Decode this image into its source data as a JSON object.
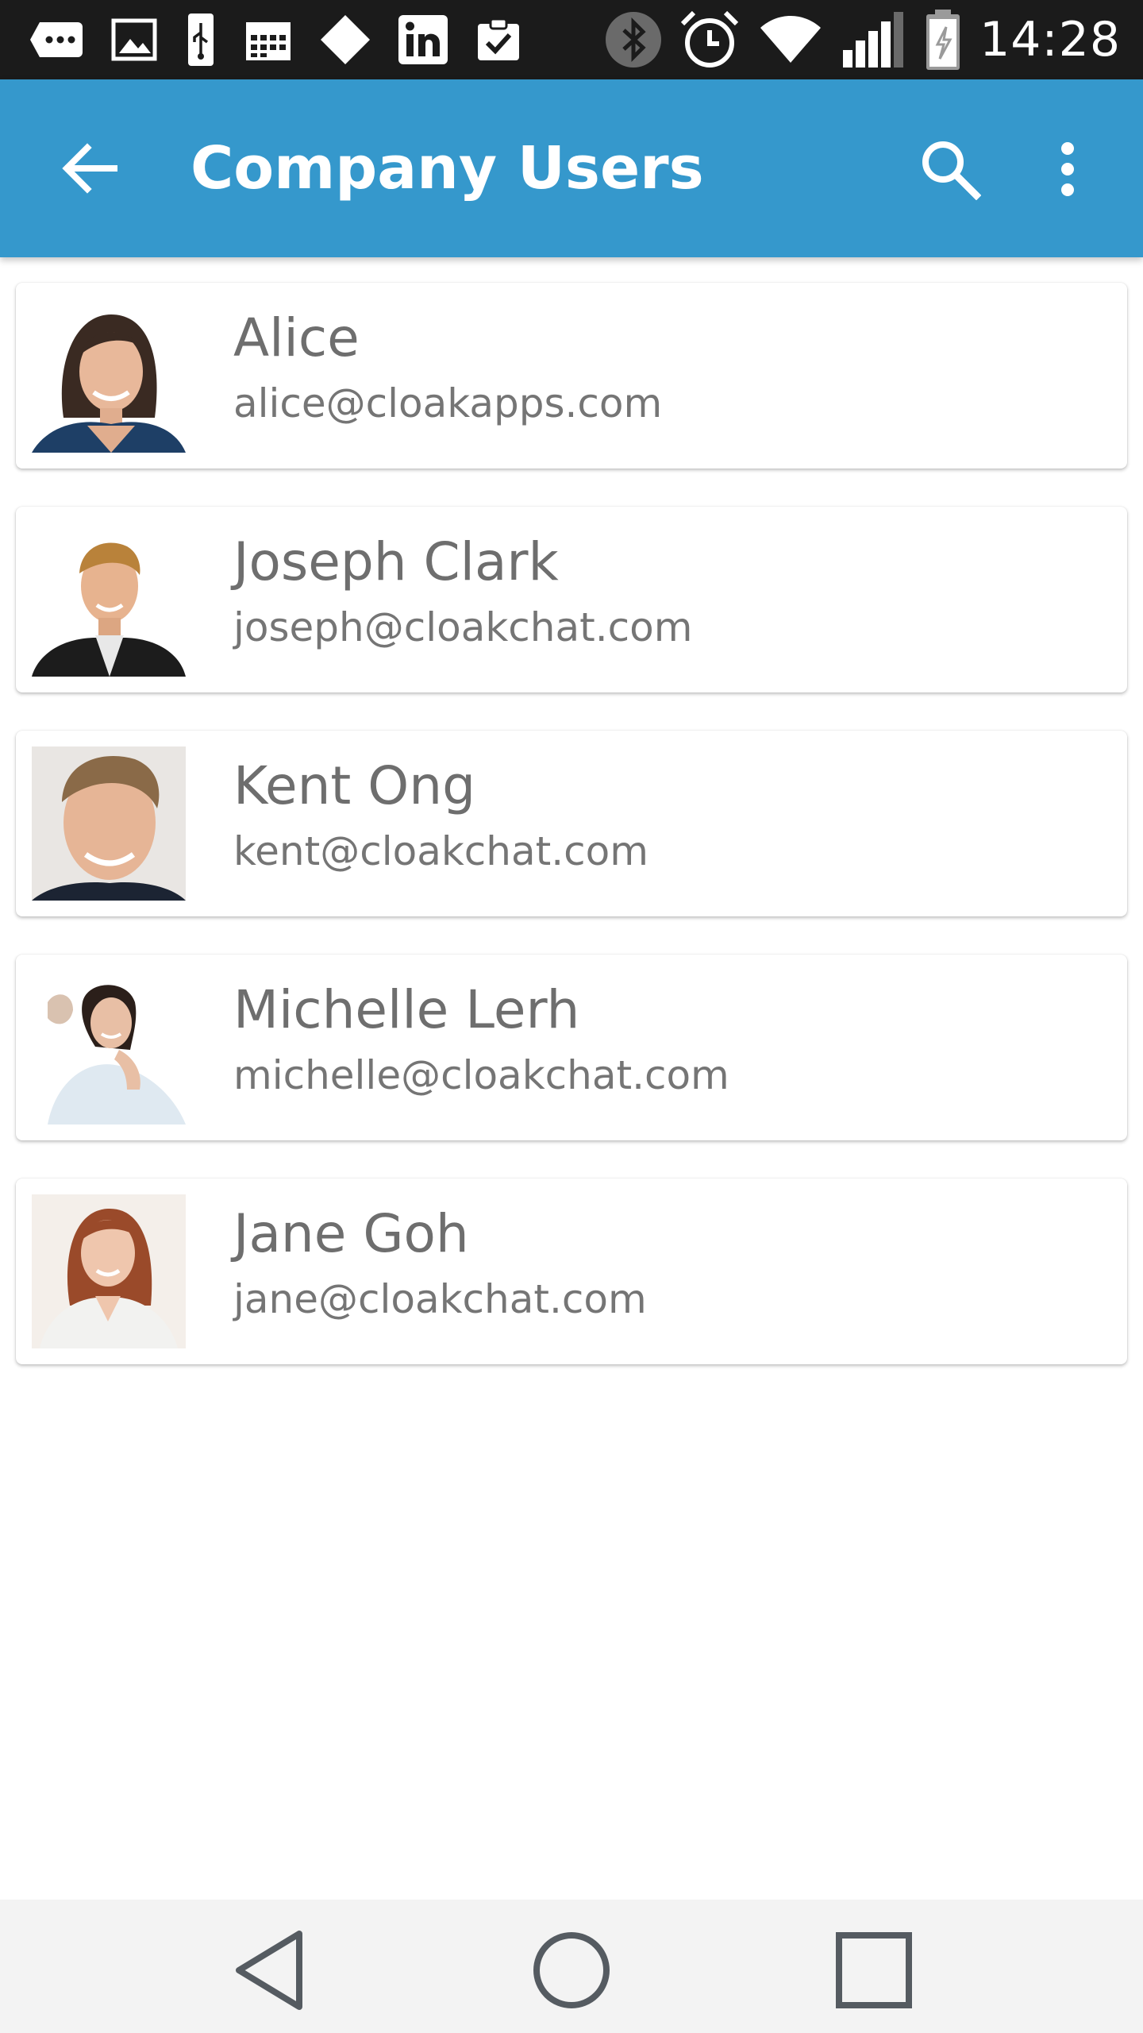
{
  "status_bar": {
    "time": "14:28",
    "left_icons": [
      "more-chat-icon",
      "image-icon",
      "usb-icon",
      "calendar-icon",
      "diamond-icon",
      "linkedin-icon",
      "clipboard-check-icon"
    ],
    "right_icons": [
      "bluetooth-icon",
      "alarm-icon",
      "wifi-icon",
      "cell-signal-icon",
      "battery-charging-icon"
    ]
  },
  "app_bar": {
    "title": "Company Users",
    "color": "#3598cc"
  },
  "users": [
    {
      "name": "Alice",
      "email": "alice@cloakapps.com"
    },
    {
      "name": "Joseph Clark",
      "email": "joseph@cloakchat.com"
    },
    {
      "name": "Kent Ong",
      "email": "kent@cloakchat.com"
    },
    {
      "name": "Michelle Lerh",
      "email": "michelle@cloakchat.com"
    },
    {
      "name": "Jane Goh",
      "email": "jane@cloakchat.com"
    }
  ]
}
